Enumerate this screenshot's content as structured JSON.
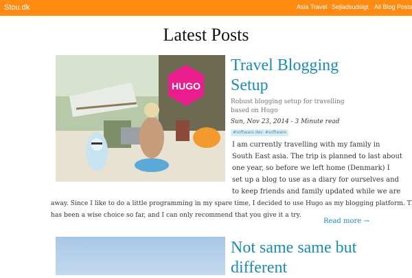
{
  "header": {
    "brand": "Stou.dk",
    "nav": [
      "Asia Travel",
      "Sejladsudsigt",
      "All Blog Posts"
    ]
  },
  "page_title": "Latest Posts",
  "posts": [
    {
      "title_lines": [
        "Travel Blogging",
        "Setup"
      ],
      "subtitle": "Robust blogging setup for travelling based on Hugo",
      "meta": "Sun, Nov 23, 2014 - 3 Minute read",
      "tags": [
        "#software development",
        "#software"
      ],
      "thumbnail_logo": "HUGO",
      "body_lines": [
        "I am currently travelling with my family in",
        "South East asia. The trip is planned to last about",
        "one year, so before we left home (Denmark) I",
        "set up a blog to use as a diary for ourselves and",
        "to keep friends and family updated while we are",
        "away. Since I like to do a little programming in my spare time, I decided to use Hugo as my blogging platform. That",
        "has been a wise choice so far, and I can only recommend that you give it a try."
      ],
      "read_more": "Read more →"
    },
    {
      "title_lines": [
        "Not same same but",
        "different"
      ]
    }
  ],
  "colors": {
    "header": "#ff8c12",
    "link": "#1a8ab8",
    "tag_bg": "#d9ecf4"
  }
}
